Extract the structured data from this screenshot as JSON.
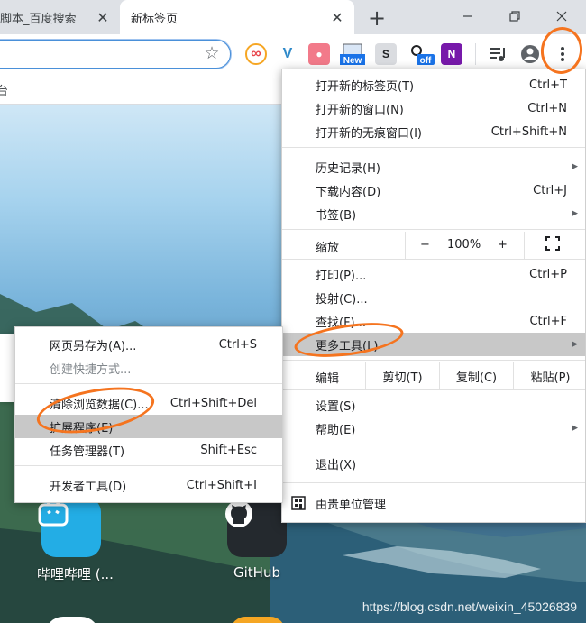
{
  "tabs": {
    "inactive_title": "脚本_百度搜索",
    "active_title": "新标签页",
    "new_tab": "+"
  },
  "window_controls": {
    "minimize": "–",
    "maximize": "❐",
    "close": "✕"
  },
  "toolbar": {
    "extensions": [
      {
        "name": "infinity-ext-icon",
        "glyph": "∞",
        "color": "#e8454c"
      },
      {
        "name": "v-ext-icon",
        "glyph": "V",
        "color": "#2e89c9"
      },
      {
        "name": "pink-ext-icon",
        "glyph": "●●",
        "color": "#f27a8a"
      },
      {
        "name": "new-ext-icon",
        "glyph": "New",
        "color": "#1a73e8"
      },
      {
        "name": "s-ext-icon",
        "glyph": "S",
        "color": "#5f6368"
      },
      {
        "name": "off-ext-icon",
        "glyph": "off",
        "color": "#1a73e8"
      },
      {
        "name": "onenote-ext-icon",
        "glyph": "N",
        "color": "#7719aa"
      }
    ]
  },
  "bookmarkbar": {
    "fragment": "台"
  },
  "main_menu": {
    "items": [
      {
        "label": "打开新的标签页(T)",
        "shortcut": "Ctrl+T"
      },
      {
        "label": "打开新的窗口(N)",
        "shortcut": "Ctrl+N"
      },
      {
        "label": "打开新的无痕窗口(I)",
        "shortcut": "Ctrl+Shift+N"
      },
      {
        "label": "历史记录(H)",
        "shortcut": "▶"
      },
      {
        "label": "下载内容(D)",
        "shortcut": "Ctrl+J"
      },
      {
        "label": "书签(B)",
        "shortcut": "▶"
      },
      {
        "label": "打印(P)...",
        "shortcut": "Ctrl+P"
      },
      {
        "label": "投射(C)...",
        "shortcut": ""
      },
      {
        "label": "查找(F)...",
        "shortcut": "Ctrl+F"
      },
      {
        "label": "更多工具(L)",
        "shortcut": "▶"
      },
      {
        "label": "设置(S)",
        "shortcut": ""
      },
      {
        "label": "帮助(E)",
        "shortcut": "▶"
      },
      {
        "label": "退出(X)",
        "shortcut": ""
      },
      {
        "label": "由贵单位管理",
        "shortcut": ""
      }
    ],
    "zoom": {
      "label": "缩放",
      "minus": "−",
      "value": "100%",
      "plus": "+"
    },
    "edit": {
      "label": "编辑",
      "cut": "剪切(T)",
      "copy": "复制(C)",
      "paste": "粘贴(P)"
    }
  },
  "submenu": {
    "items": [
      {
        "label": "网页另存为(A)...",
        "shortcut": "Ctrl+S"
      },
      {
        "label": "创建快捷方式...",
        "shortcut": ""
      },
      {
        "label": "清除浏览数据(C)...",
        "shortcut": "Ctrl+Shift+Del"
      },
      {
        "label": "扩展程序(E)",
        "shortcut": ""
      },
      {
        "label": "任务管理器(T)",
        "shortcut": "Shift+Esc"
      },
      {
        "label": "开发者工具(D)",
        "shortcut": "Ctrl+Shift+I"
      }
    ]
  },
  "shortcuts": [
    {
      "label": "哔哩哔哩 (...",
      "color": "#23ade5"
    },
    {
      "label": "GitHub",
      "color": "#24292e"
    }
  ],
  "watermark": "https://blog.csdn.net/weixin_45026839",
  "accent": "#f5741f"
}
